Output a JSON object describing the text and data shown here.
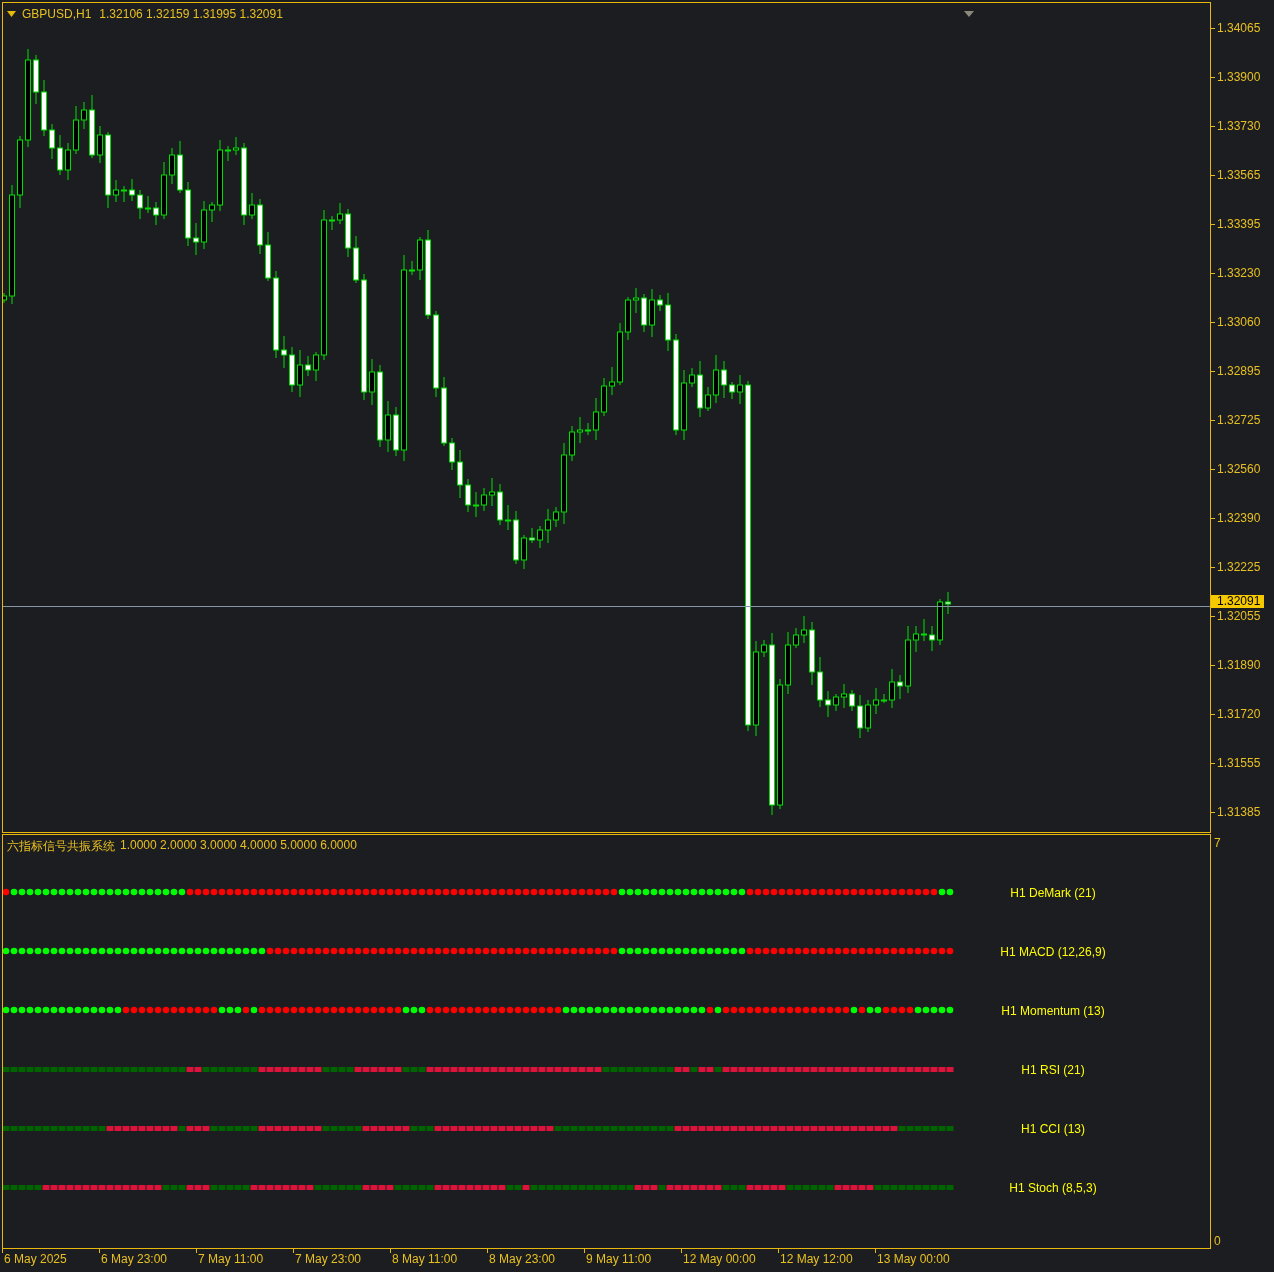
{
  "chart": {
    "symbol": "GBPUSD,H1",
    "ohlc": "1.32106 1.32159 1.31995 1.32091",
    "current_price": "1.32091",
    "price_ticks": [
      "1.34065",
      "1.33900",
      "1.33730",
      "1.33565",
      "1.33395",
      "1.33230",
      "1.33060",
      "1.32895",
      "1.32725",
      "1.32560",
      "1.32390",
      "1.32225",
      "1.32055",
      "1.31890",
      "1.31720",
      "1.31555",
      "1.31385"
    ]
  },
  "indicator_window": {
    "title": "六指标信号共振系统",
    "values": "1.0000 2.0000 3.0000 4.0000 5.0000 6.0000",
    "scale_max": "7",
    "scale_min": "0",
    "indicators": [
      {
        "label": "H1 DeMark (21)",
        "kind": "dot",
        "bullish": [
          false,
          true,
          true,
          true,
          true,
          true,
          true,
          true,
          true,
          true,
          true,
          true,
          true,
          true,
          true,
          true,
          true,
          true,
          true,
          true,
          true,
          true,
          true,
          false,
          false,
          false,
          false,
          false,
          false,
          false,
          false,
          false,
          false,
          false,
          false,
          false,
          false,
          false,
          false,
          false,
          false,
          false,
          false,
          false,
          false,
          false,
          false,
          false,
          false,
          false,
          false,
          false,
          false,
          false,
          false,
          false,
          false,
          false,
          false,
          false,
          false,
          false,
          false,
          false,
          false,
          false,
          false,
          false,
          false,
          false,
          false,
          false,
          false,
          false,
          false,
          false,
          false,
          true,
          true,
          true,
          true,
          true,
          true,
          true,
          true,
          true,
          true,
          true,
          true,
          true,
          true,
          true,
          true,
          false,
          false,
          false,
          false,
          false,
          false,
          false,
          false,
          false,
          false,
          false,
          false,
          false,
          false,
          false,
          false,
          false,
          false,
          false,
          false,
          false,
          false,
          false,
          false,
          true,
          true
        ]
      },
      {
        "label": "H1 MACD (12,26,9)",
        "kind": "dot",
        "bullish": [
          true,
          true,
          true,
          true,
          true,
          true,
          true,
          true,
          true,
          true,
          true,
          true,
          true,
          true,
          true,
          true,
          true,
          true,
          true,
          true,
          true,
          true,
          true,
          true,
          true,
          true,
          true,
          true,
          true,
          true,
          true,
          true,
          true,
          false,
          false,
          false,
          false,
          false,
          false,
          false,
          false,
          false,
          false,
          false,
          false,
          false,
          false,
          false,
          false,
          false,
          false,
          false,
          false,
          false,
          false,
          false,
          false,
          false,
          false,
          false,
          false,
          false,
          false,
          false,
          false,
          false,
          false,
          false,
          false,
          false,
          false,
          false,
          false,
          false,
          false,
          false,
          false,
          true,
          true,
          true,
          true,
          true,
          true,
          true,
          true,
          true,
          true,
          true,
          true,
          true,
          true,
          true,
          true,
          false,
          false,
          false,
          false,
          false,
          false,
          false,
          false,
          false,
          false,
          false,
          false,
          false,
          false,
          false,
          false,
          false,
          false,
          false,
          false,
          false,
          false,
          false,
          false,
          false,
          false
        ]
      },
      {
        "label": "H1 Momentum (13)",
        "kind": "dot",
        "bullish": [
          true,
          true,
          true,
          true,
          true,
          true,
          true,
          true,
          true,
          true,
          true,
          true,
          true,
          true,
          true,
          false,
          false,
          false,
          false,
          false,
          false,
          false,
          false,
          false,
          false,
          false,
          false,
          true,
          true,
          true,
          false,
          true,
          false,
          false,
          false,
          false,
          false,
          false,
          false,
          false,
          false,
          false,
          false,
          false,
          false,
          false,
          false,
          false,
          false,
          false,
          true,
          true,
          true,
          false,
          false,
          false,
          false,
          false,
          false,
          false,
          false,
          false,
          false,
          false,
          false,
          false,
          false,
          false,
          false,
          false,
          true,
          true,
          true,
          true,
          true,
          true,
          true,
          true,
          true,
          true,
          true,
          true,
          true,
          true,
          true,
          true,
          true,
          true,
          false,
          true,
          false,
          false,
          false,
          false,
          false,
          false,
          false,
          false,
          false,
          false,
          false,
          false,
          false,
          false,
          false,
          false,
          true,
          false,
          true,
          true,
          false,
          false,
          false,
          false,
          true,
          true,
          true,
          true,
          true
        ]
      },
      {
        "label": "H1 RSI (21)",
        "kind": "square",
        "bullish": [
          true,
          true,
          true,
          true,
          true,
          true,
          true,
          true,
          true,
          true,
          true,
          true,
          true,
          true,
          true,
          true,
          true,
          true,
          true,
          true,
          true,
          true,
          true,
          false,
          false,
          true,
          true,
          true,
          true,
          true,
          true,
          true,
          false,
          false,
          false,
          false,
          false,
          false,
          false,
          false,
          true,
          true,
          true,
          true,
          false,
          false,
          false,
          false,
          false,
          false,
          true,
          true,
          true,
          false,
          false,
          false,
          false,
          false,
          false,
          false,
          false,
          false,
          false,
          false,
          false,
          false,
          false,
          false,
          false,
          false,
          false,
          false,
          false,
          false,
          false,
          true,
          true,
          true,
          true,
          true,
          true,
          true,
          true,
          true,
          false,
          false,
          true,
          false,
          false,
          true,
          false,
          false,
          false,
          false,
          false,
          false,
          false,
          false,
          false,
          false,
          false,
          false,
          false,
          false,
          false,
          false,
          false,
          false,
          false,
          false,
          false,
          false,
          false,
          false,
          false,
          false,
          false,
          false,
          false
        ]
      },
      {
        "label": "H1 CCI (13)",
        "kind": "square",
        "bullish": [
          true,
          true,
          true,
          true,
          true,
          true,
          true,
          true,
          true,
          true,
          true,
          true,
          true,
          false,
          false,
          false,
          false,
          false,
          false,
          false,
          false,
          false,
          true,
          false,
          false,
          false,
          true,
          true,
          true,
          true,
          true,
          true,
          false,
          false,
          false,
          false,
          false,
          false,
          false,
          false,
          true,
          true,
          true,
          true,
          true,
          false,
          false,
          false,
          false,
          false,
          false,
          true,
          true,
          true,
          false,
          false,
          false,
          false,
          false,
          false,
          false,
          false,
          false,
          false,
          false,
          false,
          false,
          false,
          false,
          true,
          true,
          true,
          true,
          true,
          true,
          true,
          true,
          true,
          true,
          true,
          true,
          true,
          true,
          true,
          false,
          false,
          false,
          false,
          false,
          false,
          false,
          false,
          false,
          false,
          false,
          false,
          false,
          false,
          false,
          false,
          false,
          false,
          false,
          false,
          false,
          false,
          false,
          false,
          false,
          false,
          false,
          false,
          true,
          true,
          true,
          true,
          true,
          true,
          true
        ]
      },
      {
        "label": "H1 Stoch (8,5,3)",
        "kind": "square",
        "bullish": [
          true,
          true,
          true,
          true,
          true,
          false,
          false,
          false,
          false,
          false,
          false,
          false,
          false,
          false,
          false,
          false,
          false,
          false,
          false,
          false,
          true,
          true,
          true,
          false,
          false,
          false,
          true,
          true,
          true,
          true,
          true,
          false,
          false,
          false,
          false,
          false,
          false,
          false,
          false,
          true,
          true,
          true,
          true,
          true,
          true,
          false,
          false,
          false,
          false,
          true,
          true,
          true,
          true,
          true,
          false,
          false,
          false,
          false,
          false,
          false,
          false,
          false,
          false,
          true,
          true,
          false,
          true,
          true,
          true,
          true,
          true,
          true,
          true,
          true,
          true,
          true,
          true,
          true,
          true,
          false,
          false,
          false,
          true,
          false,
          false,
          false,
          false,
          false,
          false,
          false,
          true,
          true,
          true,
          false,
          false,
          false,
          false,
          false,
          true,
          true,
          true,
          true,
          true,
          true,
          false,
          false,
          false,
          false,
          false,
          true,
          true,
          true,
          true,
          true,
          true,
          true,
          true,
          true,
          true
        ]
      }
    ]
  },
  "time_axis": {
    "labels": [
      "6 May 2025",
      "6 May 23:00",
      "7 May 11:00",
      "7 May 23:00",
      "8 May 11:00",
      "8 May 23:00",
      "9 May 11:00",
      "12 May 00:00",
      "12 May 12:00",
      "13 May 00:00"
    ]
  }
}
